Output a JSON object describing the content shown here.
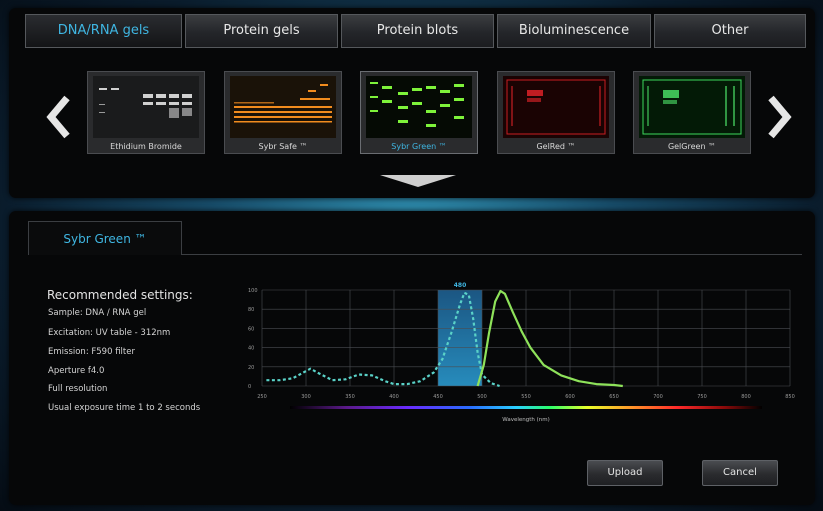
{
  "categories": [
    {
      "label": "DNA/RNA gels",
      "active": true
    },
    {
      "label": "Protein gels",
      "active": false
    },
    {
      "label": "Protein blots",
      "active": false
    },
    {
      "label": "Bioluminescence",
      "active": false
    },
    {
      "label": "Other",
      "active": false
    }
  ],
  "dyes": [
    {
      "label": "Ethidium Bromide",
      "selected": false,
      "color": "#cfcfcf"
    },
    {
      "label": "Sybr Safe ™",
      "selected": false,
      "color": "#f08a1c"
    },
    {
      "label": "Sybr Green ™",
      "selected": true,
      "color": "#8cf03a"
    },
    {
      "label": "GelRed ™",
      "selected": false,
      "color": "#e8242a"
    },
    {
      "label": "GelGreen ™",
      "selected": false,
      "color": "#4ee86a"
    }
  ],
  "detail": {
    "tab_label": "Sybr Green ™",
    "settings_title": "Recommended settings:",
    "settings": [
      "Sample: DNA / RNA gel",
      "Excitation: UV table - 312nm",
      "Emission: F590 filter",
      "Aperture f4.0",
      "Full resolution",
      "Usual exposure time 1 to 2 seconds"
    ]
  },
  "chart_data": {
    "type": "line",
    "xlabel": "Wavelength (nm)",
    "xlim": [
      250,
      850
    ],
    "ylim": [
      0,
      100
    ],
    "x_ticks": [
      250,
      300,
      350,
      400,
      450,
      500,
      550,
      600,
      650,
      700,
      750,
      800,
      850
    ],
    "y_ticks": [
      0,
      20,
      40,
      60,
      80,
      100
    ],
    "highlight": {
      "from": 450,
      "to": 500,
      "label": "480"
    },
    "series": [
      {
        "style": "dashed",
        "color": "#5ad2c8",
        "x": [
          255,
          270,
          285,
          295,
          305,
          315,
          330,
          345,
          360,
          375,
          390,
          400,
          415,
          430,
          445,
          455,
          465,
          475,
          480,
          485,
          490,
          495,
          500,
          510,
          520
        ],
        "y": [
          6,
          6,
          8,
          13,
          18,
          13,
          6,
          7,
          12,
          11,
          5,
          2,
          2,
          5,
          14,
          28,
          55,
          85,
          97,
          95,
          70,
          35,
          12,
          3,
          0
        ]
      },
      {
        "style": "solid",
        "color": "#8ee25a",
        "x": [
          495,
          502,
          508,
          515,
          521,
          526,
          535,
          545,
          555,
          570,
          590,
          610,
          630,
          650,
          660
        ],
        "y": [
          0,
          22,
          55,
          88,
          99,
          96,
          77,
          57,
          40,
          22,
          11,
          5,
          2,
          1,
          0
        ]
      }
    ]
  },
  "actions": {
    "upload": "Upload",
    "cancel": "Cancel"
  }
}
